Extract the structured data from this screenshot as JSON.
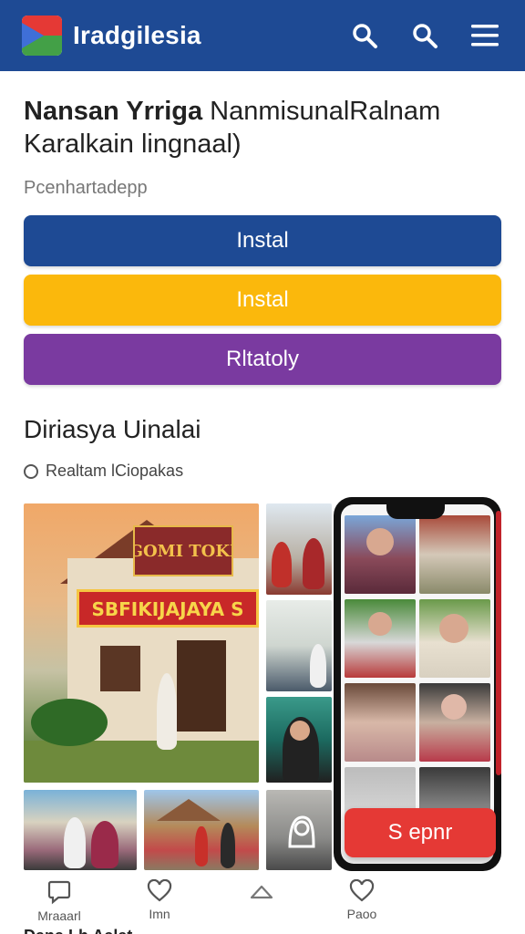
{
  "app": {
    "title": "Iradgilesia",
    "logo_name": "flag-logo",
    "brand_color": "#1e4a94"
  },
  "header": {
    "icons": [
      "search-icon",
      "search-icon",
      "menu-icon"
    ]
  },
  "content": {
    "headline_bold": "Nansan Yrriga",
    "headline_rest": " NanmisunalRalnam",
    "headline_line2": "Karalkain lingnaal)",
    "subtitle": "Pcenhartadepp",
    "buttons": [
      {
        "label": "Instal",
        "color": "#1e4a94"
      },
      {
        "label": "Instal",
        "color": "#fbb80c"
      },
      {
        "label": "Rltatoly",
        "color": "#7a3aa0"
      }
    ],
    "section_title": "Diriasya Uinalai",
    "radio_label": "Realtam lCiopakas",
    "main_photo": {
      "sign_text": "GOMI TOKI",
      "banner_text": "SBFIKIJAJAYA S"
    }
  },
  "fab": {
    "label": "S epnr",
    "color": "#e53935"
  },
  "bottom_nav": {
    "items": [
      {
        "label": "Mraaarl",
        "icon": "chat-icon"
      },
      {
        "label": "Imn",
        "icon": "heart-icon"
      },
      {
        "label": "",
        "icon": "up-arrow-icon"
      },
      {
        "label": "Paoo",
        "icon": "heart-icon"
      }
    ]
  },
  "footer_partial": "Dana Lh Aalat"
}
